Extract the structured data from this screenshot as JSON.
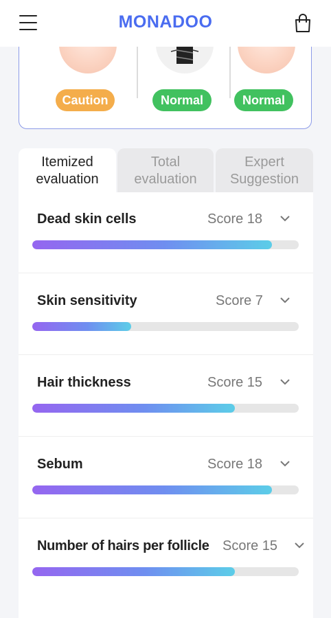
{
  "header": {
    "logo": "MONADOO"
  },
  "status": [
    {
      "label": "Caution",
      "type": "caution"
    },
    {
      "label": "Normal",
      "type": "normal"
    },
    {
      "label": "Normal",
      "type": "normal"
    }
  ],
  "tabs": [
    {
      "line1": "Itemized",
      "line2": "evaluation",
      "active": true
    },
    {
      "line1": "Total",
      "line2": "evaluation",
      "active": false
    },
    {
      "line1": "Expert",
      "line2": "Suggestion",
      "active": false
    }
  ],
  "evaluations": [
    {
      "name": "Dead skin cells",
      "score_label": "Score 18",
      "level": 0.9
    },
    {
      "name": "Skin sensitivity",
      "score_label": "Score 7",
      "level": 0.37
    },
    {
      "name": "Hair thickness",
      "score_label": "Score 15",
      "level": 0.76
    },
    {
      "name": "Sebum",
      "score_label": "Score 18",
      "level": 0.9
    },
    {
      "name": "Number of hairs per follicle",
      "score_label": "Score 15",
      "level": 0.76
    }
  ],
  "colors": {
    "brand": "#4a6cf0",
    "caution": "#f4ad4b",
    "normal": "#41c15f",
    "bar_start": "#9566f0",
    "bar_end": "#5ccde8"
  }
}
